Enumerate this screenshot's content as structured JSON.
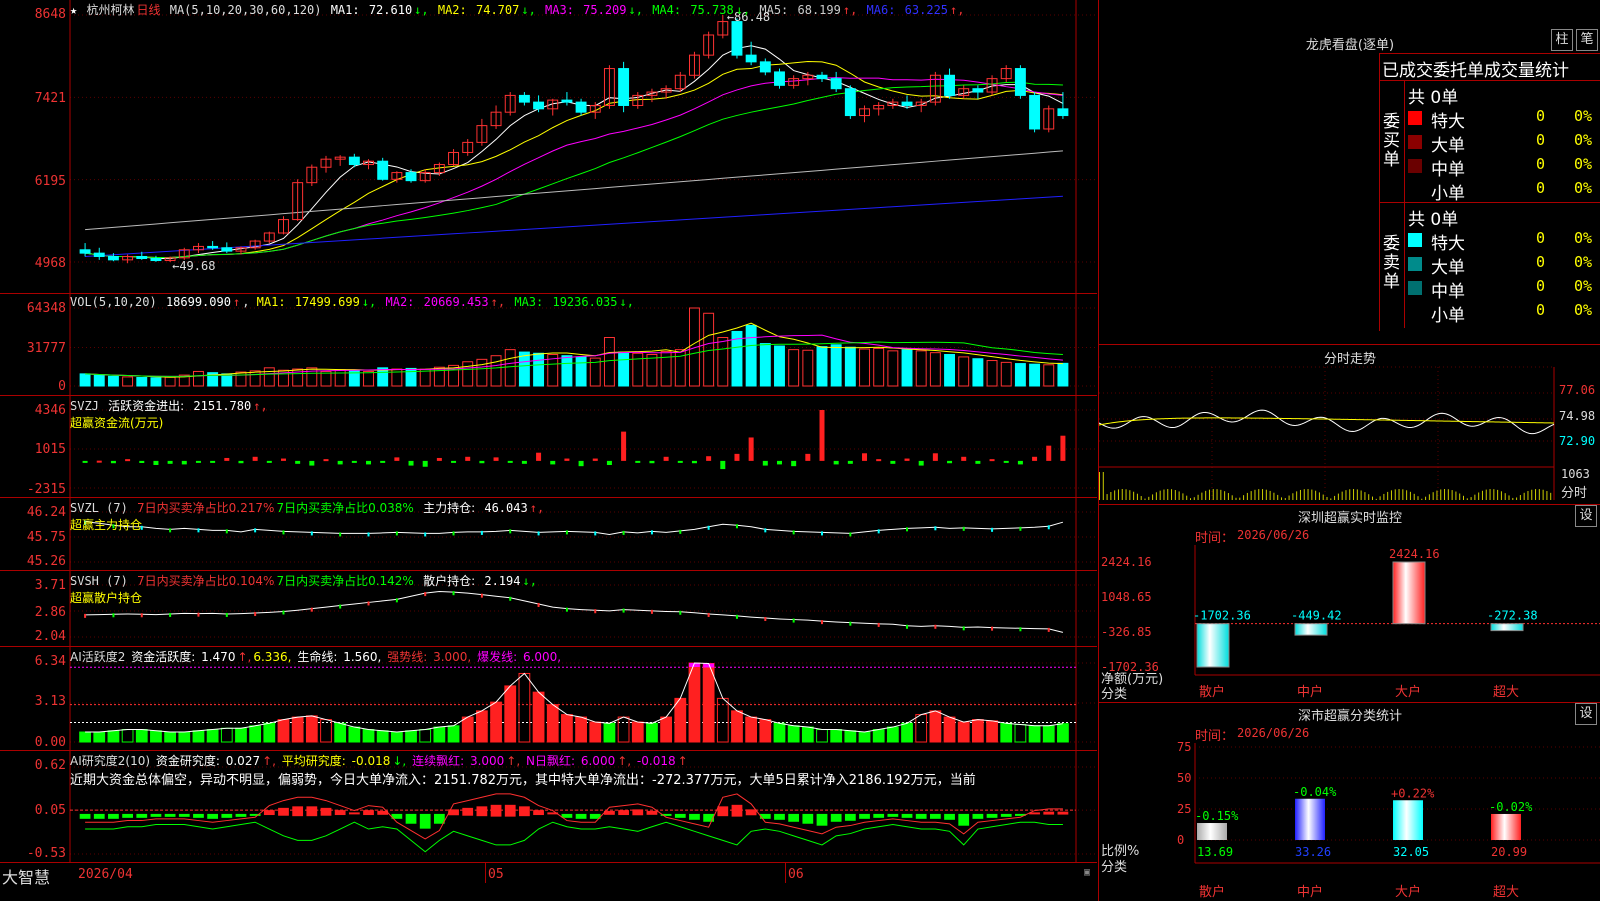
{
  "app": {
    "brand": "大智慧",
    "date_label": "2026/04"
  },
  "price_panel": {
    "star": "★",
    "name": "杭州柯林",
    "period": "日线",
    "ma_spec": "MA(5,10,20,30,60,120)",
    "ma": [
      {
        "label": "MA1:",
        "value": "72.610",
        "arrow": "↓",
        "color": "#ffffff"
      },
      {
        "label": "MA2:",
        "value": "74.707",
        "arrow": "↓",
        "color": "#ffff00"
      },
      {
        "label": "MA3:",
        "value": "75.209",
        "arrow": "↓",
        "color": "#ff00ff"
      },
      {
        "label": "MA4:",
        "value": "75.738",
        "arrow": "↓",
        "color": "#00ff00"
      },
      {
        "label": "MA5:",
        "value": "68.199",
        "arrow": "↑",
        "color": "#cccccc"
      },
      {
        "label": "MA6:",
        "value": "63.225",
        "arrow": "↑",
        "color": "#3030ff"
      }
    ],
    "yticks": [
      "8648",
      "7421",
      "6195",
      "4968"
    ],
    "high_label": "86.48",
    "low_label": "49.68"
  },
  "vol_panel": {
    "spec": "VOL(5,10,20)",
    "value": "18699.090",
    "value_arrow": "↑",
    "ma": [
      {
        "label": "MA1:",
        "value": "17499.699",
        "arrow": "↓",
        "color": "#ffff00"
      },
      {
        "label": "MA2:",
        "value": "20669.453",
        "arrow": "↑",
        "color": "#ff00ff"
      },
      {
        "label": "MA3:",
        "value": "19236.035",
        "arrow": "↓",
        "color": "#00ff00"
      }
    ],
    "yticks": [
      "64348",
      "31777",
      "0"
    ]
  },
  "svzj_panel": {
    "name": "SVZJ",
    "label": "活跃资金进出:",
    "value": "2151.780",
    "arrow": "↑,",
    "subtitle": "超赢资金流(万元)",
    "yticks": [
      "4346",
      "1015",
      "-2315"
    ]
  },
  "svzl_panel": {
    "name": "SVZL (7)",
    "t1": "7日内买卖净占比0.217%",
    "t2": "7日内买卖净占比0.038%",
    "t3": "主力持仓:",
    "value": "46.043",
    "arrow": "↑,",
    "subtitle": "超赢主力持仓",
    "yticks": [
      "46.24",
      "45.75",
      "45.26"
    ]
  },
  "svsh_panel": {
    "name": "SVSH (7)",
    "t1": "7日内买卖净占比0.104%",
    "t2": "7日内买卖净占比0.142%",
    "t3": "散户持仓:",
    "value": "2.194",
    "arrow": "↓,",
    "subtitle": "超赢散户持仓",
    "yticks": [
      "3.71",
      "2.86",
      "2.04"
    ]
  },
  "ai2_panel": {
    "name": "AI活跃度2",
    "l1": "资金活跃度:",
    "v1": "1.470",
    "a1": "↑,",
    "v2": "6.336,",
    "l3": "生命线:",
    "v3": "1.560,",
    "l4": "强势线:",
    "v4": "3.000,",
    "l5": "爆发线:",
    "v5": "6.000,",
    "yticks": [
      "6.34",
      "3.13",
      "0.00"
    ]
  },
  "ai_research_panel": {
    "name": "AI研究度2(10)",
    "l1": "资金研究度:",
    "v1": "0.027",
    "a1": "↑,",
    "l2": "平均研究度:",
    "v2": "-0.018",
    "a2": "↓,",
    "l3": "连续飘红:",
    "v3": "3.000",
    "a3": "↑,",
    "l4": "N日飘红:",
    "v4": "6.000",
    "a4": "↑,",
    "v5": "-0.018",
    "a5": "↑",
    "commentary": "近期大资金总体偏空，异动不明显，偏弱势，今日大单净流入：2151.782万元，其中特大单净流出：-272.377万元，大单5日累计净入2186.192万元，当前",
    "yticks": [
      "0.62",
      "0.05",
      "-0.53"
    ]
  },
  "x_axis": [
    "2026/04",
    "05",
    "06"
  ],
  "dragon": {
    "title": "龙虎看盘(逐单)",
    "btn1": "柱",
    "btn2": "笔",
    "header": "已成交委托单成交量统计",
    "buy_side": "委买单",
    "sell_side": "委卖单",
    "buy_total": "共 0单",
    "sell_total": "共 0单",
    "buy_rows": [
      {
        "label": "特大",
        "vol": "0",
        "pct": "0%",
        "color": "#ff0000"
      },
      {
        "label": "大单",
        "vol": "0",
        "pct": "0%",
        "color": "#8b0000"
      },
      {
        "label": "中单",
        "vol": "0",
        "pct": "0%",
        "color": "#6a0000"
      },
      {
        "label": "小单",
        "vol": "0",
        "pct": "0%",
        "color": ""
      }
    ],
    "sell_rows": [
      {
        "label": "特大",
        "vol": "0",
        "pct": "0%",
        "color": "#00ffff"
      },
      {
        "label": "大单",
        "vol": "0",
        "pct": "0%",
        "color": "#008b8b"
      },
      {
        "label": "中单",
        "vol": "0",
        "pct": "0%",
        "color": "#007070"
      },
      {
        "label": "小单",
        "vol": "0",
        "pct": "0%",
        "color": ""
      }
    ]
  },
  "intraday": {
    "title": "分时走势",
    "yticks": [
      "77.06",
      "74.98",
      "72.90"
    ],
    "vol_label": "1063",
    "unit_label": "分时"
  },
  "realtime": {
    "title": "深圳超赢实时监控",
    "settings": "设",
    "time_label": "时间：",
    "time": "2026/06/26",
    "yticks": [
      "2424.16",
      "1048.65",
      "-326.85",
      "-1702.36"
    ],
    "axis_label1": "净额(万元)",
    "axis_label2": "分类",
    "bars": [
      {
        "label": "散户",
        "value": -1702.36,
        "text": "-1702.36"
      },
      {
        "label": "中户",
        "value": -449.42,
        "text": "-449.42"
      },
      {
        "label": "大户",
        "value": 2424.16,
        "text": "2424.16"
      },
      {
        "label": "超大",
        "value": -272.38,
        "text": "-272.38"
      }
    ]
  },
  "classify": {
    "title": "深市超赢分类统计",
    "settings": "设",
    "time_label": "时间：",
    "time": "2026/06/26",
    "yticks": [
      "75",
      "50",
      "25",
      "0"
    ],
    "axis_label1": "比例%",
    "axis_label2": "分类",
    "bars": [
      {
        "label": "散户",
        "value": 13.69,
        "text": "13.69",
        "delta": "-0.15%"
      },
      {
        "label": "中户",
        "value": 33.26,
        "text": "33.26",
        "delta": "-0.04%"
      },
      {
        "label": "大户",
        "value": 32.05,
        "text": "32.05",
        "delta": "+0.22%"
      },
      {
        "label": "超大",
        "value": 20.99,
        "text": "20.99",
        "delta": "-0.02%"
      }
    ]
  },
  "colors": {
    "up": "#ff3232",
    "down": "#00ffff",
    "grid": "#aa0000",
    "axis": "#ff3232"
  },
  "chart_data": [
    {
      "type": "candlestick",
      "title": "杭州柯林 日线",
      "ylim": [
        4968,
        8648
      ],
      "x": [
        "2026/04",
        "05",
        "06"
      ],
      "ohlc": [
        [
          5150,
          5250,
          5050,
          5100
        ],
        [
          5100,
          5180,
          5000,
          5050
        ],
        [
          5050,
          5100,
          4980,
          5000
        ],
        [
          5000,
          5080,
          4950,
          5050
        ],
        [
          5050,
          5120,
          5000,
          5020
        ],
        [
          5020,
          5060,
          4970,
          4990
        ],
        [
          4990,
          5050,
          4968,
          5030
        ],
        [
          5030,
          5180,
          5000,
          5150
        ],
        [
          5150,
          5250,
          5100,
          5200
        ],
        [
          5200,
          5280,
          5150,
          5180
        ],
        [
          5180,
          5260,
          5100,
          5130
        ],
        [
          5130,
          5200,
          5080,
          5180
        ],
        [
          5180,
          5300,
          5150,
          5280
        ],
        [
          5280,
          5420,
          5250,
          5400
        ],
        [
          5400,
          5650,
          5380,
          5600
        ],
        [
          5600,
          6200,
          5580,
          6150
        ],
        [
          6150,
          6420,
          6100,
          6380
        ],
        [
          6380,
          6550,
          6300,
          6500
        ],
        [
          6500,
          6560,
          6400,
          6530
        ],
        [
          6530,
          6580,
          6380,
          6420
        ],
        [
          6420,
          6500,
          6350,
          6470
        ],
        [
          6470,
          6520,
          6180,
          6200
        ],
        [
          6200,
          6320,
          6150,
          6300
        ],
        [
          6300,
          6350,
          6150,
          6180
        ],
        [
          6180,
          6350,
          6150,
          6300
        ],
        [
          6300,
          6450,
          6250,
          6420
        ],
        [
          6420,
          6650,
          6400,
          6600
        ],
        [
          6600,
          6800,
          6550,
          6750
        ],
        [
          6750,
          7100,
          6700,
          7000
        ],
        [
          7000,
          7300,
          6950,
          7200
        ],
        [
          7200,
          7500,
          7150,
          7450
        ],
        [
          7450,
          7500,
          7300,
          7350
        ],
        [
          7350,
          7450,
          7200,
          7250
        ],
        [
          7250,
          7400,
          7150,
          7380
        ],
        [
          7380,
          7500,
          7300,
          7350
        ],
        [
          7350,
          7400,
          7150,
          7200
        ],
        [
          7200,
          7350,
          7100,
          7300
        ],
        [
          7300,
          7900,
          7250,
          7850
        ],
        [
          7850,
          7950,
          7200,
          7300
        ],
        [
          7300,
          7500,
          7250,
          7450
        ],
        [
          7450,
          7550,
          7350,
          7500
        ],
        [
          7500,
          7600,
          7400,
          7550
        ],
        [
          7550,
          7800,
          7500,
          7750
        ],
        [
          7750,
          8100,
          7700,
          8050
        ],
        [
          8050,
          8400,
          8000,
          8350
        ],
        [
          8350,
          8648,
          8300,
          8550
        ],
        [
          8550,
          8600,
          8000,
          8050
        ],
        [
          8050,
          8250,
          7900,
          7950
        ],
        [
          7950,
          8000,
          7750,
          7800
        ],
        [
          7800,
          7850,
          7550,
          7600
        ],
        [
          7600,
          7750,
          7550,
          7700
        ],
        [
          7700,
          7800,
          7600,
          7750
        ],
        [
          7750,
          7800,
          7650,
          7700
        ],
        [
          7700,
          7800,
          7500,
          7550
        ],
        [
          7550,
          7600,
          7100,
          7150
        ],
        [
          7150,
          7300,
          7050,
          7250
        ],
        [
          7250,
          7350,
          7150,
          7300
        ],
        [
          7300,
          7400,
          7250,
          7350
        ],
        [
          7350,
          7450,
          7250,
          7300
        ],
        [
          7300,
          7400,
          7200,
          7350
        ],
        [
          7350,
          7800,
          7300,
          7750
        ],
        [
          7750,
          7850,
          7400,
          7450
        ],
        [
          7450,
          7600,
          7400,
          7550
        ],
        [
          7550,
          7600,
          7400,
          7500
        ],
        [
          7500,
          7750,
          7450,
          7700
        ],
        [
          7700,
          7900,
          7650,
          7850
        ],
        [
          7850,
          7900,
          7400,
          7450
        ],
        [
          7450,
          7500,
          6900,
          6950
        ],
        [
          6950,
          7300,
          6900,
          7250
        ],
        [
          7250,
          7500,
          7100,
          7150
        ]
      ]
    },
    {
      "type": "bar",
      "title": "VOL(5,10,20)",
      "ylim": [
        0,
        64348
      ],
      "values": [
        10000,
        9000,
        8000,
        7500,
        7000,
        6800,
        7200,
        9000,
        12000,
        11000,
        10000,
        11500,
        12500,
        15000,
        13000,
        14000,
        15000,
        12000,
        13500,
        13000,
        12000,
        15000,
        14000,
        14500,
        13800,
        15500,
        17000,
        20000,
        22000,
        25000,
        30000,
        28000,
        27000,
        26000,
        25000,
        24000,
        23000,
        40000,
        28000,
        27000,
        26000,
        28500,
        30000,
        64348,
        60000,
        40000,
        45000,
        50000,
        35000,
        33000,
        30000,
        29500,
        32500,
        34000,
        32000,
        30500,
        31000,
        29000,
        30000,
        29000,
        27500,
        26000,
        24000,
        22500,
        21000,
        19500,
        18500,
        18000,
        17500,
        18699
      ]
    },
    {
      "type": "bar",
      "title": "SVZJ 活跃资金进出",
      "ylim": [
        -2315,
        4346
      ],
      "values": [
        -50,
        20,
        -200,
        150,
        -180,
        -350,
        -250,
        -300,
        -150,
        -100,
        250,
        -200,
        350,
        -50,
        200,
        -250,
        -400,
        150,
        -300,
        -120,
        -300,
        -150,
        300,
        -400,
        -500,
        250,
        -150,
        350,
        -200,
        300,
        -120,
        -250,
        700,
        -300,
        200,
        -450,
        200,
        -350,
        2500,
        -150,
        -200,
        350,
        -150,
        -200,
        400,
        -700,
        600,
        2000,
        -400,
        -300,
        -450,
        600,
        4346,
        -300,
        -250,
        650,
        150,
        -250,
        200,
        -400,
        650,
        -200,
        350,
        -250,
        150,
        -100,
        -300,
        350,
        1300,
        2151
      ]
    },
    {
      "type": "line",
      "title": "SVZL 主力持仓",
      "ylim": [
        45.26,
        46.24
      ],
      "values": [
        46.05,
        46.02,
        45.98,
        45.95,
        45.95,
        45.92,
        45.9,
        45.92,
        45.9,
        45.88,
        45.88,
        45.85,
        45.9,
        45.88,
        45.86,
        45.85,
        45.84,
        45.83,
        45.82,
        45.82,
        45.82,
        45.83,
        45.84,
        45.83,
        45.82,
        45.82,
        45.84,
        45.85,
        45.85,
        45.86,
        45.88,
        45.86,
        45.84,
        45.85,
        45.86,
        45.85,
        45.84,
        45.8,
        45.85,
        45.83,
        45.86,
        45.84,
        45.87,
        45.9,
        45.95,
        46.0,
        45.98,
        45.95,
        45.9,
        45.88,
        45.86,
        45.85,
        45.84,
        45.83,
        45.82,
        45.85,
        45.88,
        45.9,
        45.92,
        45.93,
        45.94,
        45.92,
        45.93,
        45.92,
        45.91,
        45.92,
        45.93,
        45.94,
        45.96,
        46.04
      ]
    },
    {
      "type": "line",
      "title": "SVSH 散户持仓",
      "ylim": [
        2.04,
        3.71
      ],
      "values": [
        2.75,
        2.76,
        2.77,
        2.78,
        2.77,
        2.76,
        2.78,
        2.8,
        2.79,
        2.8,
        2.78,
        2.79,
        2.81,
        2.83,
        2.86,
        2.9,
        2.95,
        3.0,
        3.05,
        3.1,
        3.15,
        3.2,
        3.25,
        3.35,
        3.45,
        3.5,
        3.48,
        3.45,
        3.4,
        3.35,
        3.3,
        3.2,
        3.1,
        3.0,
        2.95,
        2.92,
        2.9,
        2.88,
        2.92,
        2.9,
        2.88,
        2.86,
        2.85,
        2.82,
        2.78,
        2.75,
        2.72,
        2.68,
        2.65,
        2.62,
        2.6,
        2.58,
        2.55,
        2.52,
        2.5,
        2.48,
        2.46,
        2.45,
        2.4,
        2.38,
        2.4,
        2.38,
        2.35,
        2.36,
        2.34,
        2.33,
        2.32,
        2.31,
        2.3,
        2.19
      ]
    },
    {
      "type": "bar",
      "title": "AI活跃度2 资金活跃度",
      "ylim": [
        0,
        6.34
      ],
      "values": [
        0.8,
        0.8,
        0.9,
        1.0,
        1.0,
        0.9,
        0.8,
        0.8,
        0.9,
        1.0,
        1.1,
        1.1,
        1.3,
        1.5,
        1.8,
        2.0,
        2.1,
        1.8,
        1.5,
        1.2,
        1.0,
        0.9,
        0.8,
        0.9,
        1.0,
        1.2,
        1.3,
        2.0,
        2.5,
        3.2,
        4.5,
        5.5,
        4.0,
        3.0,
        2.2,
        2.0,
        1.6,
        1.5,
        2.0,
        1.6,
        1.5,
        2.0,
        3.5,
        6.34,
        6.3,
        3.5,
        2.5,
        2.0,
        1.8,
        1.5,
        1.3,
        1.2,
        1.0,
        1.0,
        0.9,
        0.8,
        1.0,
        1.2,
        1.5,
        2.2,
        2.5,
        2.0,
        1.6,
        1.8,
        1.7,
        1.5,
        1.4,
        1.3,
        1.3,
        1.47
      ]
    },
    {
      "type": "bar",
      "title": "AI研究度2(10) 资金研究度",
      "ylim": [
        -0.53,
        0.62
      ],
      "values": [
        -0.05,
        -0.05,
        -0.05,
        -0.04,
        -0.04,
        -0.03,
        -0.03,
        -0.03,
        -0.04,
        -0.05,
        -0.04,
        -0.03,
        -0.02,
        0.05,
        0.08,
        0.1,
        0.1,
        0.08,
        0.05,
        0.02,
        0.05,
        0.04,
        -0.05,
        -0.1,
        -0.15,
        -0.1,
        0.06,
        0.08,
        0.1,
        0.12,
        0.12,
        0.1,
        0.05,
        0.02,
        -0.04,
        -0.05,
        -0.05,
        0.04,
        0.05,
        0.06,
        0.04,
        -0.02,
        -0.04,
        -0.06,
        -0.08,
        0.1,
        0.12,
        0.06,
        -0.05,
        -0.06,
        -0.08,
        -0.1,
        -0.12,
        -0.08,
        -0.07,
        -0.05,
        -0.04,
        -0.03,
        -0.04,
        -0.05,
        -0.05,
        -0.06,
        -0.12,
        -0.05,
        -0.04,
        -0.03,
        -0.02,
        0.02,
        0.03,
        0.03
      ]
    }
  ]
}
